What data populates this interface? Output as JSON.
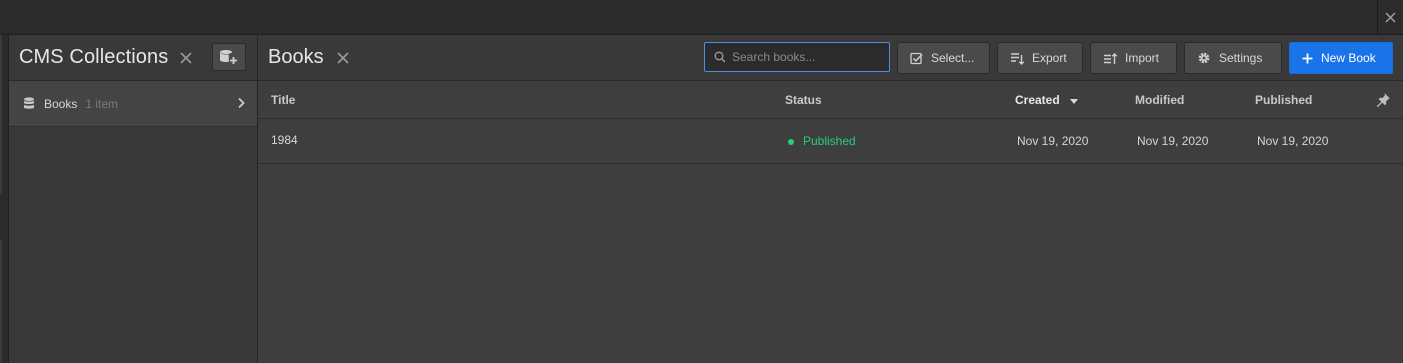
{
  "collections_panel": {
    "title": "CMS Collections",
    "items": [
      {
        "name": "Books",
        "count": "1 item"
      }
    ]
  },
  "main": {
    "title": "Books",
    "search": {
      "placeholder": "Search books...",
      "value": ""
    },
    "toolbar": {
      "select_label": "Select...",
      "export_label": "Export",
      "import_label": "Import",
      "settings_label": "Settings",
      "new_label": "New Book"
    },
    "columns": {
      "title": "Title",
      "status": "Status",
      "created": "Created",
      "modified": "Modified",
      "published": "Published"
    },
    "rows": [
      {
        "title": "1984",
        "status": "Published",
        "created": "Nov 19, 2020",
        "modified": "Nov 19, 2020",
        "published": "Nov 19, 2020"
      }
    ]
  },
  "colors": {
    "accent": "#1a73e8",
    "status_published": "#26d07c",
    "panel_bg": "#393939",
    "content_bg": "#3e3e3e"
  },
  "icons": [
    "close-icon",
    "add-collection-icon",
    "database-icon",
    "chevron-right-icon",
    "search-icon",
    "checkbox-icon",
    "export-icon",
    "import-icon",
    "gear-icon",
    "plus-icon",
    "sort-desc-icon",
    "pin-icon"
  ]
}
